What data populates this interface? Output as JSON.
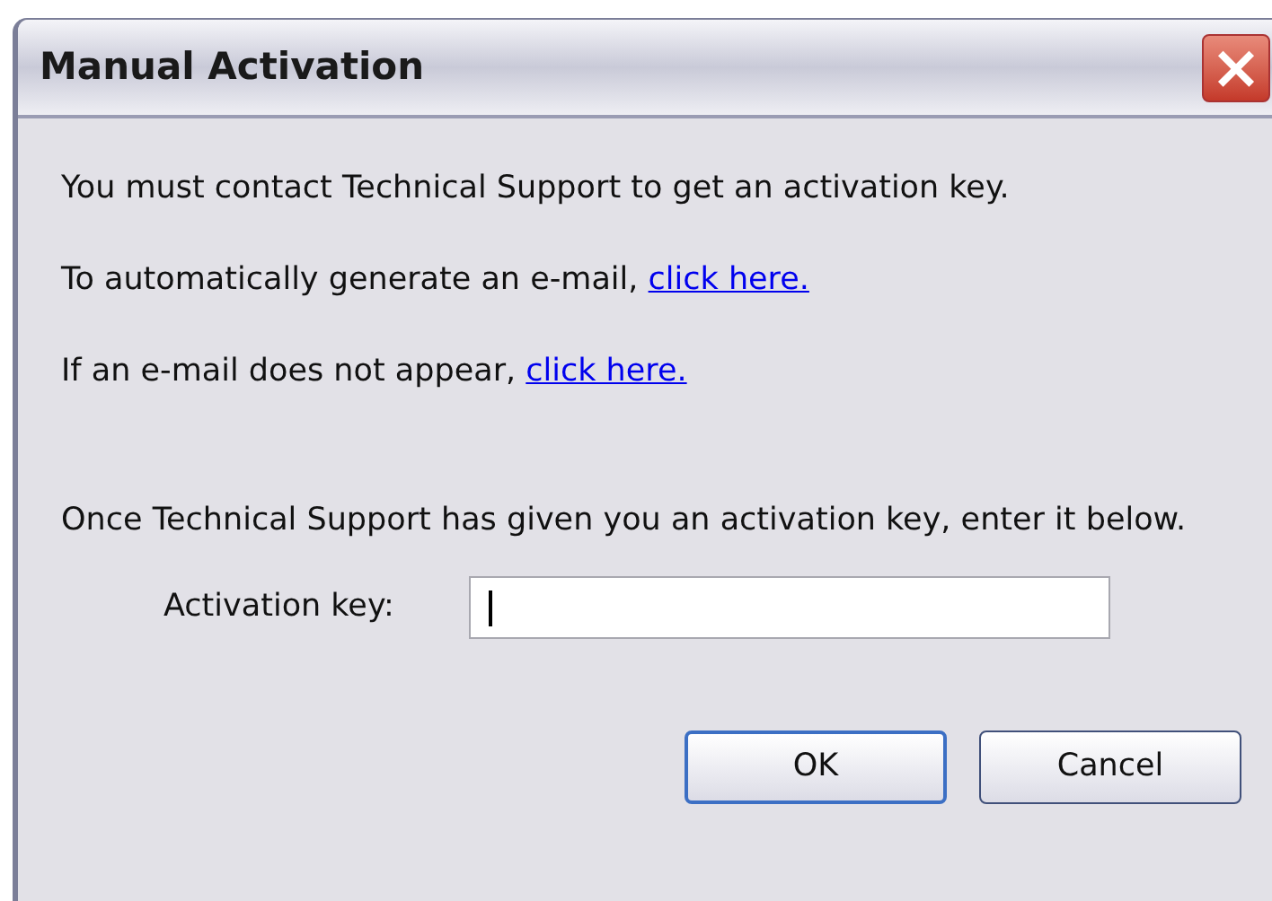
{
  "window": {
    "title": "Manual Activation",
    "close": "×"
  },
  "lines": [
    {
      "text": "You must contact Technical Support to get an activation key."
    },
    {
      "text": "To automatically generate an e-mail, ",
      "link": "click here."
    },
    {
      "text": "If an e-mail does not appear, ",
      "link": "click here."
    }
  ],
  "instruction": "Once Technical Support has given you an activation key, enter it below.",
  "field": {
    "label": "Activation key:",
    "focused": true
  },
  "buttons": [
    {
      "label": "OK",
      "default": true
    },
    {
      "label": "Cancel",
      "default": false
    }
  ]
}
